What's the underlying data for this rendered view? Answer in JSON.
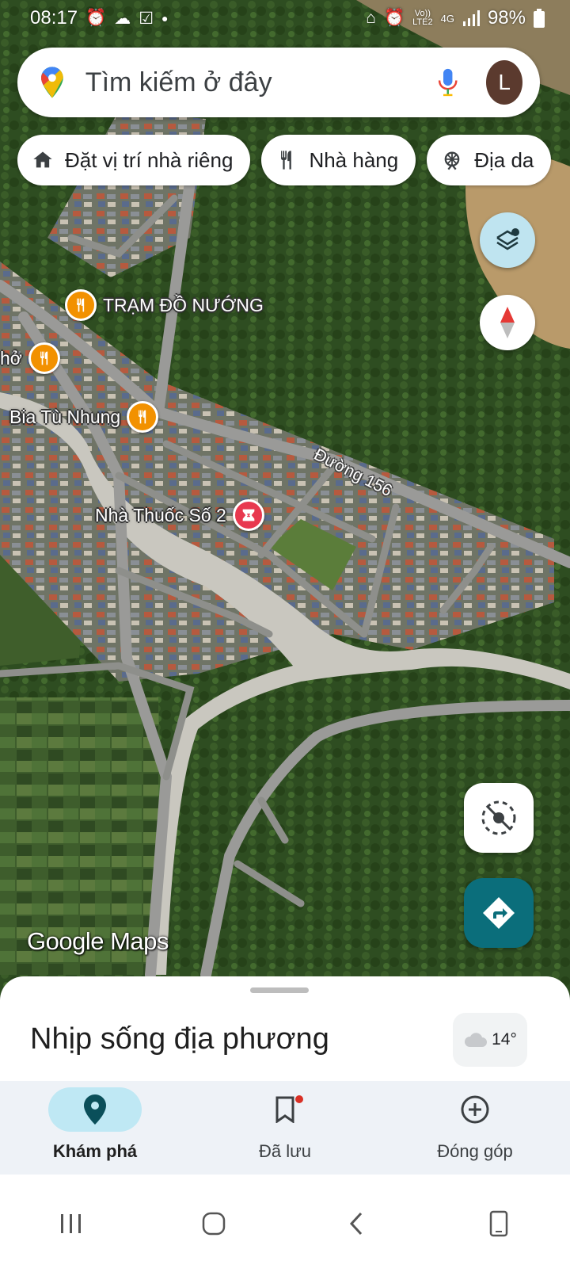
{
  "status_bar": {
    "time": "08:17",
    "network_top": "Vo))",
    "network_bottom": "LTE2",
    "signal_type": "4G",
    "battery": "98%",
    "icons": [
      "alarm-icon",
      "cloud-icon",
      "checkbox-icon",
      "dot-icon",
      "home-icon",
      "alarm-icon",
      "signal-icon",
      "battery-icon"
    ]
  },
  "search": {
    "placeholder": "Tìm kiếm ở đây",
    "avatar_letter": "L"
  },
  "chips": [
    {
      "label": "Đặt vị trí nhà riêng",
      "icon": "home-icon"
    },
    {
      "label": "Nhà hàng",
      "icon": "restaurant-icon"
    },
    {
      "label": "Địa da",
      "icon": "attraction-icon"
    }
  ],
  "map": {
    "pois": [
      {
        "label": "TRẠM ĐỒ NƯỚNG",
        "icon": "restaurant-icon"
      },
      {
        "label": "hở",
        "icon": "restaurant-icon"
      },
      {
        "label": "Bia Tù Nhung",
        "icon": "restaurant-icon"
      },
      {
        "label": "Nhà Thuốc Số 2",
        "icon": "pharmacy-icon"
      }
    ],
    "road_label": "Đường 156",
    "attribution": "Google Maps"
  },
  "sheet": {
    "title": "Nhịp sống địa phương",
    "weather_temp": "14°",
    "weather_icon": "cloud-icon"
  },
  "bottom_nav": [
    {
      "label": "Khám phá",
      "icon": "location-pin-icon",
      "active": true
    },
    {
      "label": "Đã lưu",
      "icon": "bookmark-icon",
      "active": false,
      "badge": true
    },
    {
      "label": "Đóng góp",
      "icon": "add-circle-icon",
      "active": false
    }
  ],
  "colors": {
    "accent": "#0b6e7b",
    "nav_active": "#bfe8f4",
    "poi_food": "#f29100",
    "poi_pharmacy": "#e8384f"
  }
}
